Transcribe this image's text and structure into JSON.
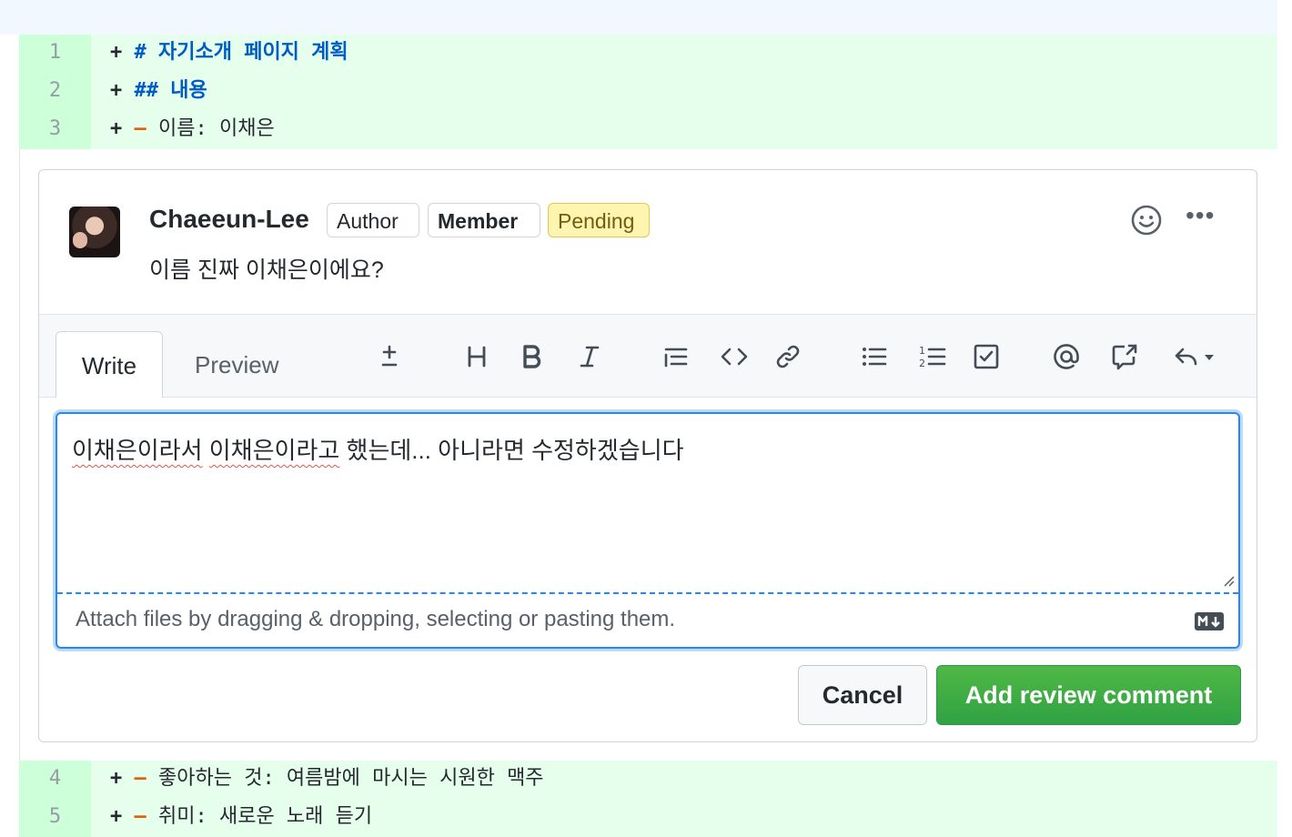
{
  "diff": {
    "top_lines": [
      {
        "num": "1",
        "sign": "+",
        "prefix": "#",
        "text": "자기소개 페이지 계획"
      },
      {
        "num": "2",
        "sign": "+",
        "prefix": "##",
        "text": "내용"
      },
      {
        "num": "3",
        "sign": "+",
        "prefix": "–",
        "text": "이름: 이채은"
      }
    ],
    "bottom_lines": [
      {
        "num": "4",
        "sign": "+",
        "prefix": "–",
        "text": "좋아하는 것: 여름밤에 마시는 시원한 맥주"
      },
      {
        "num": "5",
        "sign": "+",
        "prefix": "–",
        "text": "취미: 새로운 노래 듣기"
      }
    ]
  },
  "comment": {
    "author": "Chaeeun-Lee",
    "badges": {
      "author": "Author",
      "member": "Member",
      "pending": "Pending"
    },
    "body": "이름 진짜 이채은이에요?",
    "more_label": "•••"
  },
  "editor": {
    "tabs": {
      "write": "Write",
      "preview": "Preview"
    },
    "textarea_value_part1": "이채은이라서",
    "textarea_value_part2": "이채은이라고",
    "textarea_value_part3": "했는데... 아니라면 수정하겠습니다",
    "attach_hint": "Attach files by dragging & dropping, selecting or pasting them.",
    "toolbar_icons": [
      "plus-minus-icon",
      "heading-icon",
      "bold-icon",
      "italic-icon",
      "quote-icon",
      "code-icon",
      "link-icon",
      "bulleted-list-icon",
      "numbered-list-icon",
      "task-list-icon",
      "mention-icon",
      "cross-reference-icon",
      "saved-replies-icon"
    ]
  },
  "actions": {
    "cancel": "Cancel",
    "submit": "Add review comment"
  },
  "colors": {
    "addition_bg": "#e6ffed",
    "addition_num_bg": "#cdffd8",
    "primary": "#2ea44f",
    "focus": "#2188ff"
  }
}
